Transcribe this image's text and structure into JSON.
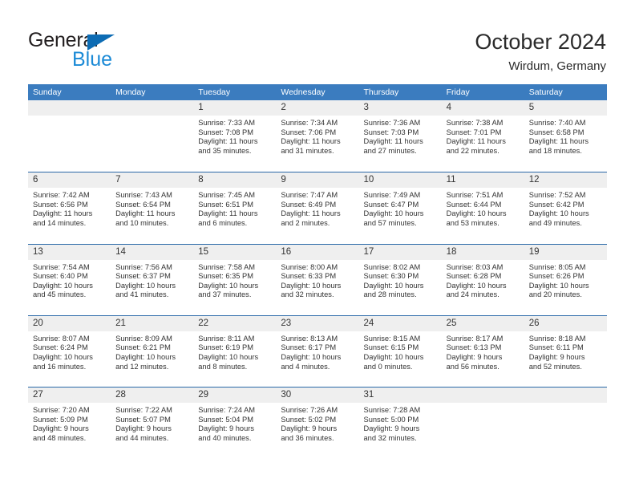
{
  "brand": {
    "name_top": "General",
    "name_bottom": "Blue",
    "color_dark": "#231f20",
    "color_blue": "#1b8ad6",
    "triangle_color": "#0d6cb4"
  },
  "header": {
    "title": "October 2024",
    "subtitle": "Wirdum, Germany"
  },
  "theme": {
    "header_bar": "#3b7cbf",
    "week_divider": "#2a69a8",
    "daynum_band": "#efefef",
    "text": "#333333"
  },
  "weekdays": [
    "Sunday",
    "Monday",
    "Tuesday",
    "Wednesday",
    "Thursday",
    "Friday",
    "Saturday"
  ],
  "weeks": [
    [
      {
        "day": "",
        "lines": []
      },
      {
        "day": "",
        "lines": []
      },
      {
        "day": "1",
        "lines": [
          "Sunrise: 7:33 AM",
          "Sunset: 7:08 PM",
          "Daylight: 11 hours",
          "and 35 minutes."
        ]
      },
      {
        "day": "2",
        "lines": [
          "Sunrise: 7:34 AM",
          "Sunset: 7:06 PM",
          "Daylight: 11 hours",
          "and 31 minutes."
        ]
      },
      {
        "day": "3",
        "lines": [
          "Sunrise: 7:36 AM",
          "Sunset: 7:03 PM",
          "Daylight: 11 hours",
          "and 27 minutes."
        ]
      },
      {
        "day": "4",
        "lines": [
          "Sunrise: 7:38 AM",
          "Sunset: 7:01 PM",
          "Daylight: 11 hours",
          "and 22 minutes."
        ]
      },
      {
        "day": "5",
        "lines": [
          "Sunrise: 7:40 AM",
          "Sunset: 6:58 PM",
          "Daylight: 11 hours",
          "and 18 minutes."
        ]
      }
    ],
    [
      {
        "day": "6",
        "lines": [
          "Sunrise: 7:42 AM",
          "Sunset: 6:56 PM",
          "Daylight: 11 hours",
          "and 14 minutes."
        ]
      },
      {
        "day": "7",
        "lines": [
          "Sunrise: 7:43 AM",
          "Sunset: 6:54 PM",
          "Daylight: 11 hours",
          "and 10 minutes."
        ]
      },
      {
        "day": "8",
        "lines": [
          "Sunrise: 7:45 AM",
          "Sunset: 6:51 PM",
          "Daylight: 11 hours",
          "and 6 minutes."
        ]
      },
      {
        "day": "9",
        "lines": [
          "Sunrise: 7:47 AM",
          "Sunset: 6:49 PM",
          "Daylight: 11 hours",
          "and 2 minutes."
        ]
      },
      {
        "day": "10",
        "lines": [
          "Sunrise: 7:49 AM",
          "Sunset: 6:47 PM",
          "Daylight: 10 hours",
          "and 57 minutes."
        ]
      },
      {
        "day": "11",
        "lines": [
          "Sunrise: 7:51 AM",
          "Sunset: 6:44 PM",
          "Daylight: 10 hours",
          "and 53 minutes."
        ]
      },
      {
        "day": "12",
        "lines": [
          "Sunrise: 7:52 AM",
          "Sunset: 6:42 PM",
          "Daylight: 10 hours",
          "and 49 minutes."
        ]
      }
    ],
    [
      {
        "day": "13",
        "lines": [
          "Sunrise: 7:54 AM",
          "Sunset: 6:40 PM",
          "Daylight: 10 hours",
          "and 45 minutes."
        ]
      },
      {
        "day": "14",
        "lines": [
          "Sunrise: 7:56 AM",
          "Sunset: 6:37 PM",
          "Daylight: 10 hours",
          "and 41 minutes."
        ]
      },
      {
        "day": "15",
        "lines": [
          "Sunrise: 7:58 AM",
          "Sunset: 6:35 PM",
          "Daylight: 10 hours",
          "and 37 minutes."
        ]
      },
      {
        "day": "16",
        "lines": [
          "Sunrise: 8:00 AM",
          "Sunset: 6:33 PM",
          "Daylight: 10 hours",
          "and 32 minutes."
        ]
      },
      {
        "day": "17",
        "lines": [
          "Sunrise: 8:02 AM",
          "Sunset: 6:30 PM",
          "Daylight: 10 hours",
          "and 28 minutes."
        ]
      },
      {
        "day": "18",
        "lines": [
          "Sunrise: 8:03 AM",
          "Sunset: 6:28 PM",
          "Daylight: 10 hours",
          "and 24 minutes."
        ]
      },
      {
        "day": "19",
        "lines": [
          "Sunrise: 8:05 AM",
          "Sunset: 6:26 PM",
          "Daylight: 10 hours",
          "and 20 minutes."
        ]
      }
    ],
    [
      {
        "day": "20",
        "lines": [
          "Sunrise: 8:07 AM",
          "Sunset: 6:24 PM",
          "Daylight: 10 hours",
          "and 16 minutes."
        ]
      },
      {
        "day": "21",
        "lines": [
          "Sunrise: 8:09 AM",
          "Sunset: 6:21 PM",
          "Daylight: 10 hours",
          "and 12 minutes."
        ]
      },
      {
        "day": "22",
        "lines": [
          "Sunrise: 8:11 AM",
          "Sunset: 6:19 PM",
          "Daylight: 10 hours",
          "and 8 minutes."
        ]
      },
      {
        "day": "23",
        "lines": [
          "Sunrise: 8:13 AM",
          "Sunset: 6:17 PM",
          "Daylight: 10 hours",
          "and 4 minutes."
        ]
      },
      {
        "day": "24",
        "lines": [
          "Sunrise: 8:15 AM",
          "Sunset: 6:15 PM",
          "Daylight: 10 hours",
          "and 0 minutes."
        ]
      },
      {
        "day": "25",
        "lines": [
          "Sunrise: 8:17 AM",
          "Sunset: 6:13 PM",
          "Daylight: 9 hours",
          "and 56 minutes."
        ]
      },
      {
        "day": "26",
        "lines": [
          "Sunrise: 8:18 AM",
          "Sunset: 6:11 PM",
          "Daylight: 9 hours",
          "and 52 minutes."
        ]
      }
    ],
    [
      {
        "day": "27",
        "lines": [
          "Sunrise: 7:20 AM",
          "Sunset: 5:09 PM",
          "Daylight: 9 hours",
          "and 48 minutes."
        ]
      },
      {
        "day": "28",
        "lines": [
          "Sunrise: 7:22 AM",
          "Sunset: 5:07 PM",
          "Daylight: 9 hours",
          "and 44 minutes."
        ]
      },
      {
        "day": "29",
        "lines": [
          "Sunrise: 7:24 AM",
          "Sunset: 5:04 PM",
          "Daylight: 9 hours",
          "and 40 minutes."
        ]
      },
      {
        "day": "30",
        "lines": [
          "Sunrise: 7:26 AM",
          "Sunset: 5:02 PM",
          "Daylight: 9 hours",
          "and 36 minutes."
        ]
      },
      {
        "day": "31",
        "lines": [
          "Sunrise: 7:28 AM",
          "Sunset: 5:00 PM",
          "Daylight: 9 hours",
          "and 32 minutes."
        ]
      },
      {
        "day": "",
        "lines": []
      },
      {
        "day": "",
        "lines": []
      }
    ]
  ]
}
